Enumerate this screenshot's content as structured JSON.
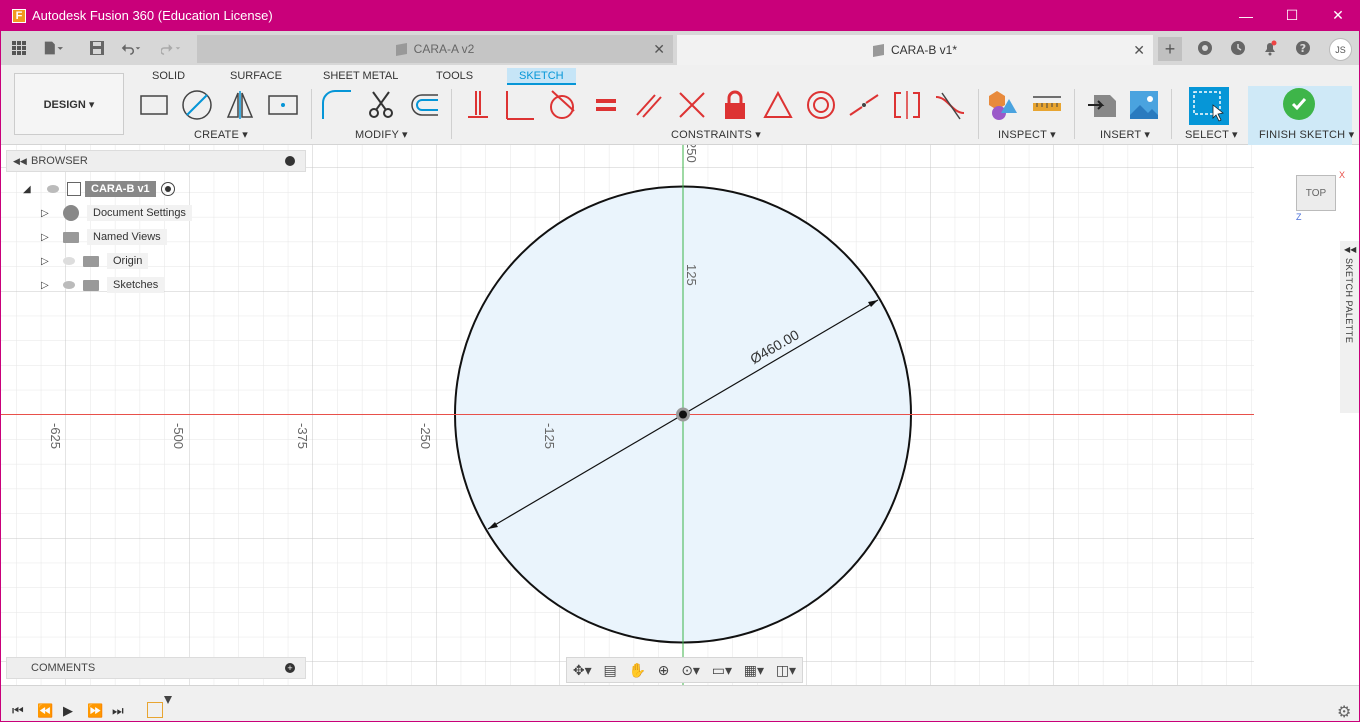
{
  "window": {
    "title": "Autodesk Fusion 360 (Education License)",
    "logo_letter": "F",
    "minimize": "—",
    "maximize": "☐",
    "close": "✕"
  },
  "tabs": {
    "inactive_label": "CARA-A v2",
    "active_label": "CARA-B v1*",
    "close_glyph": "✕",
    "new_tab": "+",
    "user_initials": "JS"
  },
  "toolbar": {
    "workspace_tabs": [
      "SOLID",
      "SURFACE",
      "SHEET METAL",
      "TOOLS",
      "SKETCH"
    ],
    "active_workspace": "SKETCH",
    "design_label": "DESIGN ▾",
    "groups": {
      "create": "CREATE ▾",
      "modify": "MODIFY ▾",
      "constraints": "CONSTRAINTS ▾",
      "inspect": "INSPECT ▾",
      "insert": "INSERT ▾",
      "select": "SELECT ▾",
      "finish": "FINISH SKETCH ▾"
    }
  },
  "browser": {
    "title": "BROWSER",
    "root": "CARA-B v1",
    "items": [
      {
        "label": "Document Settings",
        "icon": "gear-icon"
      },
      {
        "label": "Named Views",
        "icon": "folder-icon"
      },
      {
        "label": "Origin",
        "icon": "folder-icon"
      },
      {
        "label": "Sketches",
        "icon": "folder-icon"
      }
    ]
  },
  "comments": {
    "title": "COMMENTS"
  },
  "canvas": {
    "dimension_label": "Ø460.00",
    "x_ticks": [
      "-625",
      "-500",
      "-375",
      "-250",
      "-125"
    ],
    "y_ticks": [
      "250",
      "125"
    ],
    "axis_color_x": "#e8504a",
    "axis_color_y": "#3cb34a",
    "circle_fill": "#eaf4fc"
  },
  "viewcube": {
    "face": "TOP",
    "x_axis": "X",
    "z_axis": "Z"
  },
  "palette": {
    "label": "SKETCH PALETTE"
  },
  "colors": {
    "title_bar": "#c9007a",
    "accent": "#0696d7",
    "finish_green": "#3eb549"
  }
}
